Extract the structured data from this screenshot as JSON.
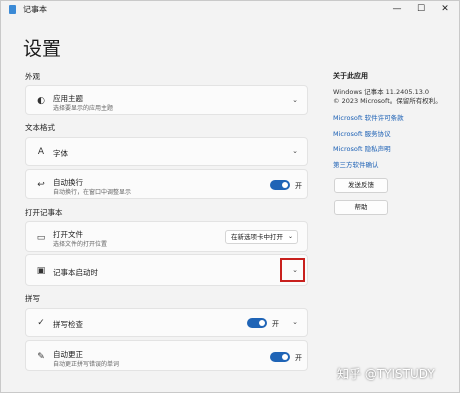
{
  "window": {
    "title": "记事本",
    "minimize": "—",
    "maximize": "☐",
    "close": "✕"
  },
  "page_title": "设置",
  "sections": {
    "appearance": "外观",
    "text_format": "文本格式",
    "open_notepad": "打开记事本",
    "spelling": "拼写"
  },
  "settings": {
    "theme": {
      "label": "应用主题",
      "sub": "选择要显示的应用主题"
    },
    "font": {
      "label": "字体"
    },
    "wrap": {
      "label": "自动换行",
      "sub": "自动换行，在窗口中调整显示",
      "state": "开",
      "on": true
    },
    "open_file": {
      "label": "打开文件",
      "sub": "选择文件的打开位置",
      "value": "在新选项卡中打开"
    },
    "startup": {
      "label": "记事本启动时"
    },
    "spellcheck": {
      "label": "拼写检查",
      "state": "开",
      "on": true
    },
    "autocorrect": {
      "label": "自动更正",
      "sub": "自动更正拼写错误的单词",
      "state": "开",
      "on": true
    }
  },
  "about": {
    "heading": "关于此应用",
    "version": "Windows 记事本 11.2405.13.0",
    "copyright": "© 2023 Microsoft。保留所有权利。",
    "links": [
      "Microsoft 软件许可条款",
      "Microsoft 服务协议",
      "Microsoft 隐私声明",
      "第三方软件确认"
    ],
    "feedback_button": "发送反馈",
    "help_button": "帮助"
  },
  "watermark": "知乎 @TYISTUDY",
  "colors": {
    "accent": "#1f64b6",
    "link": "#1a5fb4",
    "highlight": "#c8201d"
  }
}
